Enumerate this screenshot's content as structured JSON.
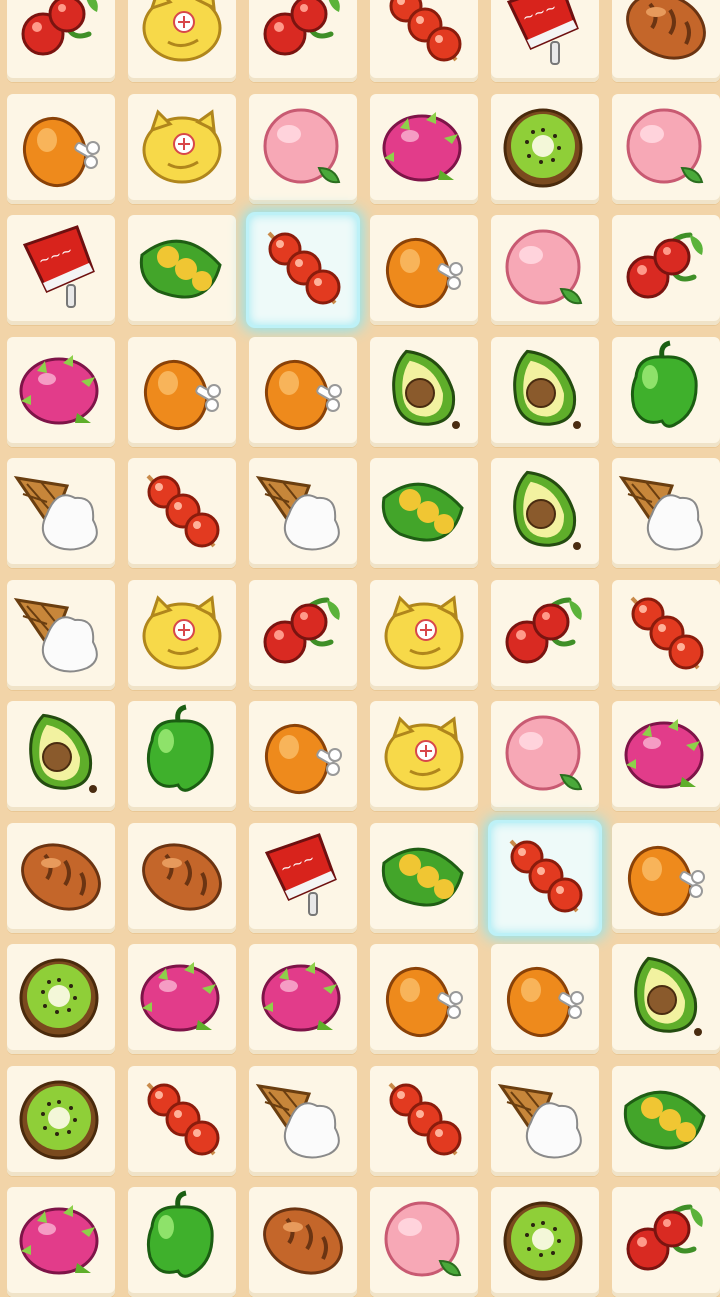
{
  "game": {
    "columns": 6,
    "rows": 11,
    "grid": [
      [
        "cherry",
        "lemon-cat",
        "cherry",
        "tanghulu",
        "cola-cup",
        "bread"
      ],
      [
        "chicken-leg",
        "lemon-cat",
        "peach",
        "dragon-fruit",
        "kiwi",
        "peach"
      ],
      [
        "cola-cup",
        "pea-pod",
        "tanghulu",
        "chicken-leg",
        "peach",
        "cherry"
      ],
      [
        "dragon-fruit",
        "chicken-leg",
        "chicken-leg",
        "avocado",
        "avocado",
        "green-pepper"
      ],
      [
        "ice-cream-cone",
        "tanghulu",
        "ice-cream-cone",
        "pea-pod",
        "avocado",
        "ice-cream-cone"
      ],
      [
        "ice-cream-cone",
        "lemon-cat",
        "cherry",
        "lemon-cat",
        "cherry",
        "tanghulu"
      ],
      [
        "avocado",
        "green-pepper",
        "chicken-leg",
        "lemon-cat",
        "peach",
        "dragon-fruit"
      ],
      [
        "bread",
        "bread",
        "cola-cup",
        "pea-pod",
        "tanghulu",
        "chicken-leg"
      ],
      [
        "kiwi",
        "dragon-fruit",
        "dragon-fruit",
        "chicken-leg",
        "chicken-leg",
        "avocado"
      ],
      [
        "kiwi",
        "tanghulu",
        "ice-cream-cone",
        "tanghulu",
        "ice-cream-cone",
        "pea-pod"
      ],
      [
        "dragon-fruit",
        "green-pepper",
        "bread",
        "peach",
        "kiwi",
        "cherry"
      ]
    ],
    "selected_tiles": [
      [
        2,
        2
      ],
      [
        7,
        4
      ]
    ]
  },
  "colors": {
    "board_bg": "#f2d4a8",
    "tile_face": "#fdf6e6",
    "selection_glow": "#8fe4f0"
  }
}
